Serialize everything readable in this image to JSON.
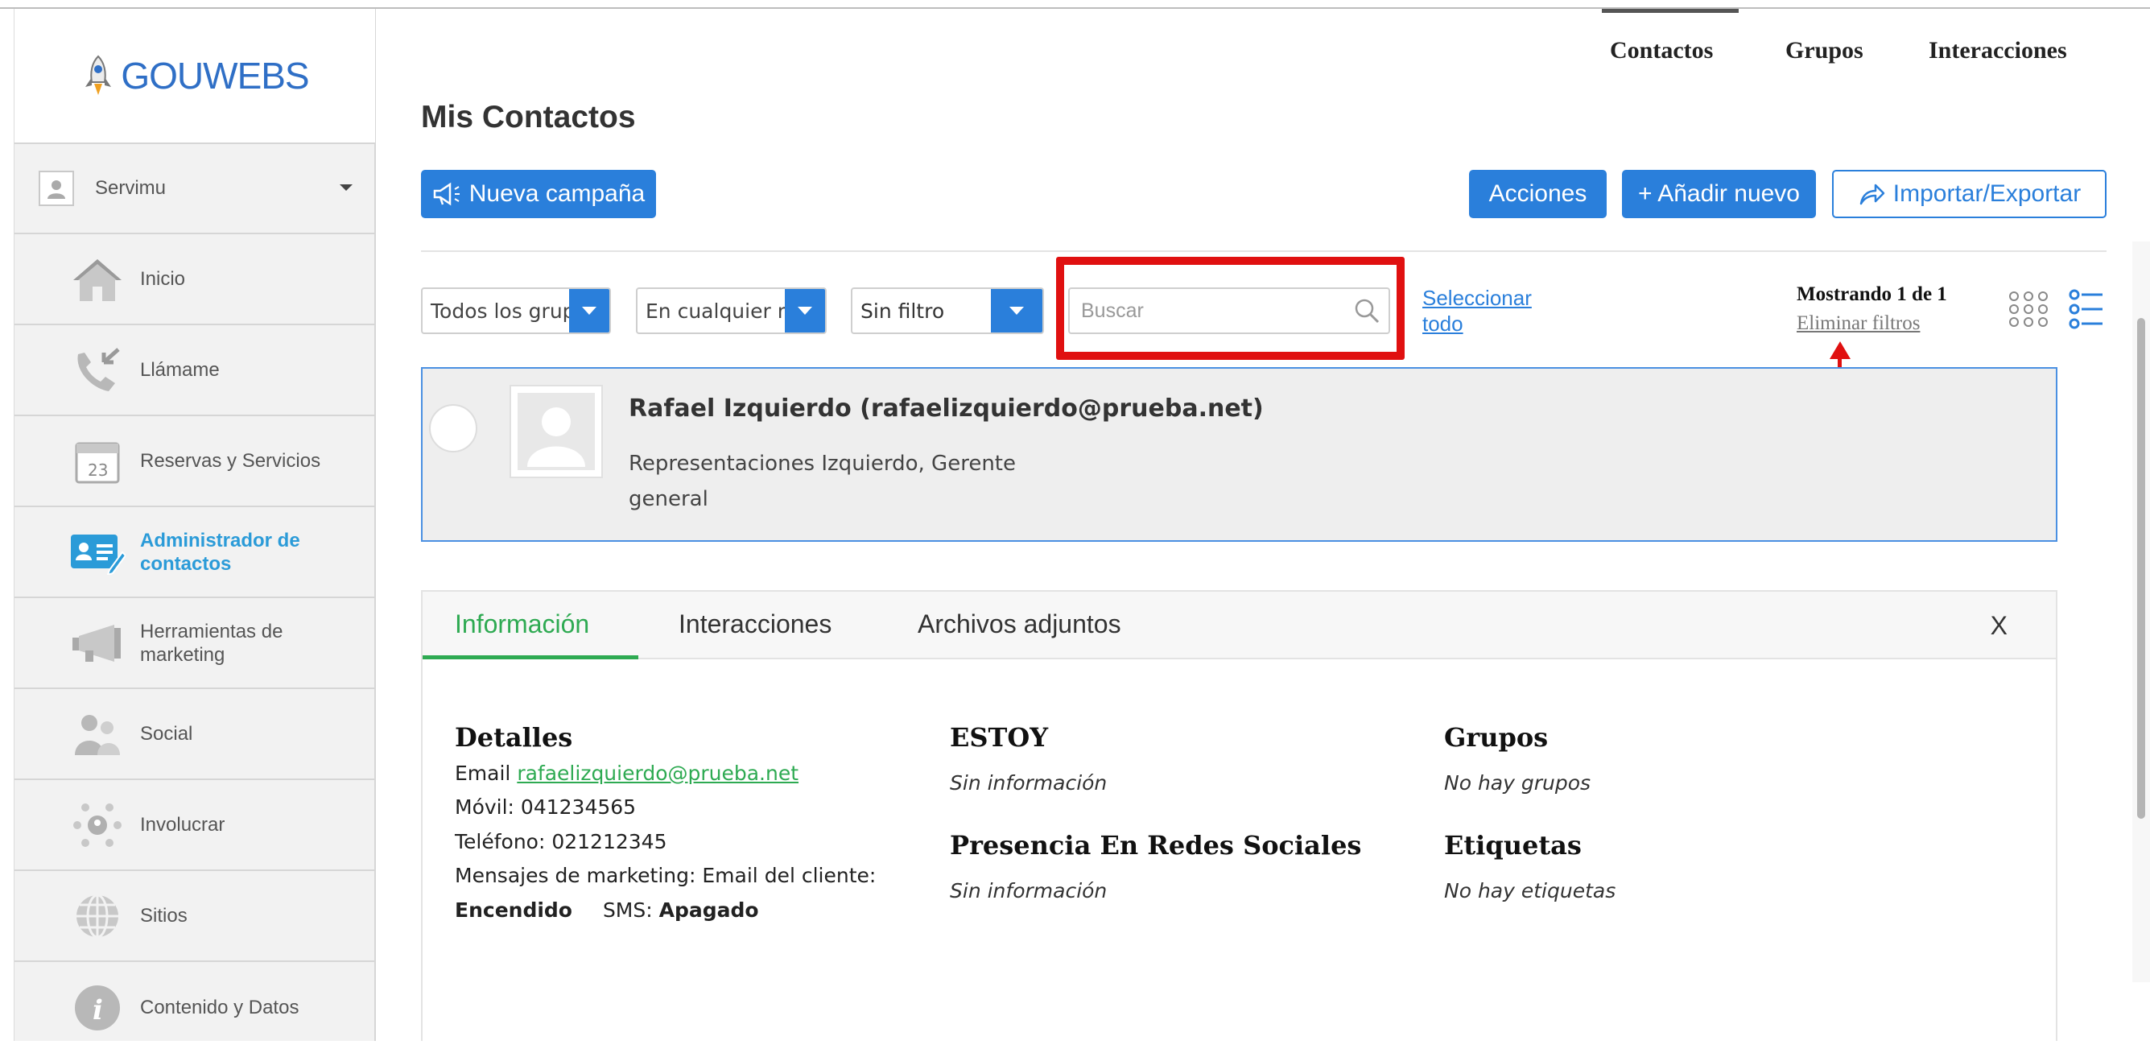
{
  "brand": {
    "logo_text": "GOUWEBS",
    "accent": "#2a7fdb",
    "highlight": "#e01010",
    "success": "#2eaa52"
  },
  "sidebar": {
    "account": {
      "name": "Servimu"
    },
    "items": [
      {
        "label": "Inicio",
        "icon": "home-icon"
      },
      {
        "label": "Llámame",
        "icon": "phone-icon"
      },
      {
        "label": "Reservas y Servicios",
        "icon": "calendar-icon"
      },
      {
        "label": "Administrador de contactos",
        "icon": "contact-card-icon",
        "active": true
      },
      {
        "label": "Herramientas de marketing",
        "icon": "megaphone-icon"
      },
      {
        "label": "Social",
        "icon": "people-icon"
      },
      {
        "label": "Involucrar",
        "icon": "network-icon"
      },
      {
        "label": "Sitios",
        "icon": "globe-icon"
      },
      {
        "label": "Contenido y Datos",
        "icon": "info-icon"
      }
    ]
  },
  "topnav": {
    "contacts": "Contactos",
    "groups": "Grupos",
    "interactions": "Interacciones"
  },
  "page": {
    "title": "Mis Contactos"
  },
  "toolbar": {
    "new_campaign": "Nueva campaña",
    "actions": "Acciones",
    "add_new": "+ Añadir nuevo",
    "import_export": "Importar/Exportar"
  },
  "filters": {
    "groups": "Todos los grupos",
    "when": "En cualquier momento",
    "filter": "Sin filtro",
    "search_placeholder": "Buscar",
    "select_all_1": "Seleccionar",
    "select_all_2": "todo",
    "showing": "Mostrando 1 de 1",
    "clear_filters": "Eliminar filtros"
  },
  "contact": {
    "name": "Rafael Izquierdo (rafaelizquierdo@prueba.net)",
    "company": "Representaciones Izquierdo, Gerente general"
  },
  "detail_tabs": {
    "info": "Información",
    "interactions": "Interacciones",
    "attachments": "Archivos adjuntos",
    "close": "X"
  },
  "details": {
    "heading": "Detalles",
    "email_label": "Email",
    "email": "rafaelizquierdo@prueba.net",
    "mobile": "Móvil: 041234565",
    "phone": "Teléfono: 021212345",
    "marketing": "Mensajes de marketing: Email del cliente:",
    "email_status": "Encendido",
    "sms_label": "SMS:",
    "sms_status": "Apagado"
  },
  "estoy": {
    "heading": "ESTOY",
    "value": "Sin información"
  },
  "social": {
    "heading": "Presencia En Redes Sociales",
    "value": "Sin información"
  },
  "groups": {
    "heading": "Grupos",
    "value": "No hay grupos"
  },
  "tags": {
    "heading": "Etiquetas",
    "value": "No hay etiquetas"
  }
}
